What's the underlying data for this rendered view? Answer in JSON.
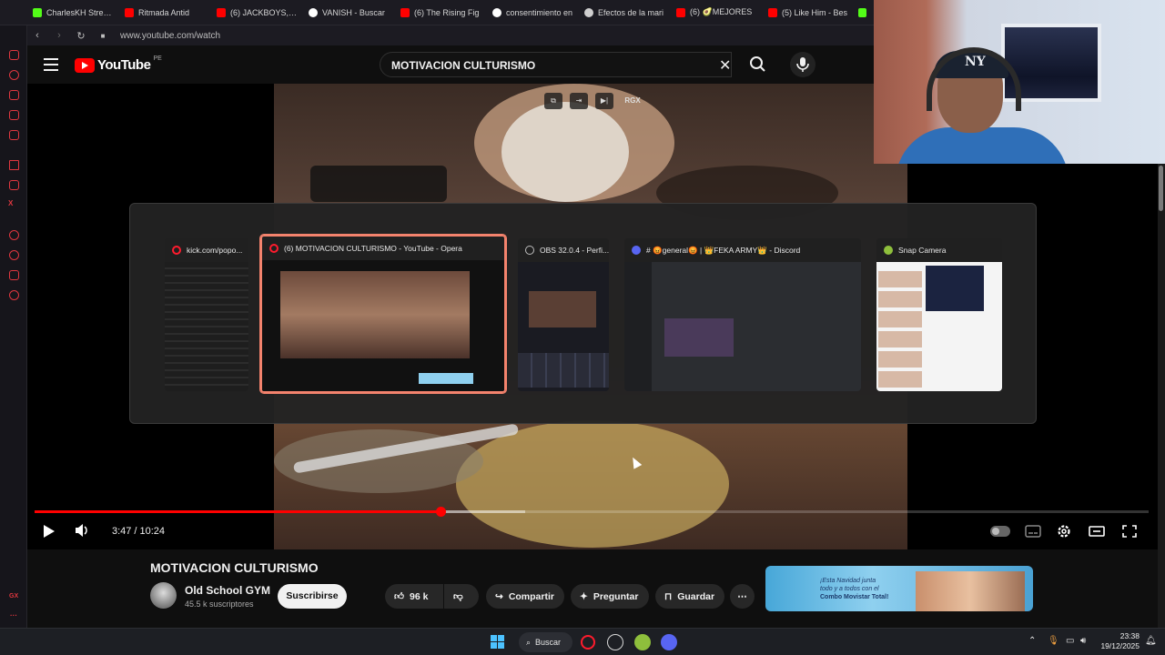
{
  "browser": {
    "tabs": [
      {
        "label": "CharlesKH Stream",
        "icon": "kick-icon",
        "color": "#53fc18"
      },
      {
        "label": "Ritmada Antid",
        "icon": "youtube-icon",
        "color": "#ff0000"
      },
      {
        "label": "(6) JACKBOYS, Tr",
        "icon": "youtube-icon",
        "color": "#ff0000"
      },
      {
        "label": "VANISH - Buscar",
        "icon": "google-icon",
        "color": "#ffffff"
      },
      {
        "label": "(6) The Rising Fig",
        "icon": "youtube-icon",
        "color": "#ff0000"
      },
      {
        "label": "consentimiento en",
        "icon": "google-icon",
        "color": "#ffffff"
      },
      {
        "label": "Efectos de la mari",
        "icon": "openai-icon",
        "color": "#cfcfcf"
      },
      {
        "label": "(6) 🥑MEJORES",
        "icon": "youtube-icon",
        "color": "#ff0000"
      },
      {
        "label": "(5) Like Him - Bes",
        "icon": "youtube-icon",
        "color": "#ff0000"
      }
    ],
    "url": "www.youtube.com/watch"
  },
  "youtube": {
    "logo_text": "YouTube",
    "country_code": "PE",
    "search_value": "MOTIVACION CULTURISMO",
    "player": {
      "current_time": "3:47",
      "duration": "10:24",
      "progress_fraction": 0.364,
      "buffered_fraction": 0.44,
      "overlay_label": "RGX"
    },
    "video_title": "MOTIVACION CULTURISMO",
    "channel_name": "Old School GYM",
    "subscribers": "45.5 k suscriptores",
    "subscribe_label": "Suscribirse",
    "likes": "96 k",
    "share_label": "Compartir",
    "ask_label": "Preguntar",
    "save_label": "Guardar",
    "ad_text_line1": "¡Esta Navidad junta",
    "ad_text_line2": "todo y a todos con el",
    "ad_text_line3": "Combo Movistar Total!"
  },
  "switcher": {
    "windows": [
      {
        "title": "kick.com/popo...",
        "icon_color": "#ff1b2d"
      },
      {
        "title": "(6) MOTIVACION CULTURISMO - YouTube - Opera",
        "icon_color": "#ff1b2d"
      },
      {
        "title": "OBS 32.0.4 - Perfi...",
        "icon_color": "#bdbdbd"
      },
      {
        "title": "# 😡general😡 | 👑FEKA ARMY👑 - Discord",
        "icon_color": "#5865f2"
      },
      {
        "title": "Snap Camera",
        "icon_color": "#8ebf3c"
      }
    ]
  },
  "taskbar": {
    "search_label": "Buscar",
    "time": "23:38",
    "date": "19/12/2025"
  },
  "colors": {
    "accent_red": "#ff0000",
    "opera_red": "#ff1b2d",
    "selection": "#f4836d",
    "windows_blue": "#4cc2ff"
  }
}
